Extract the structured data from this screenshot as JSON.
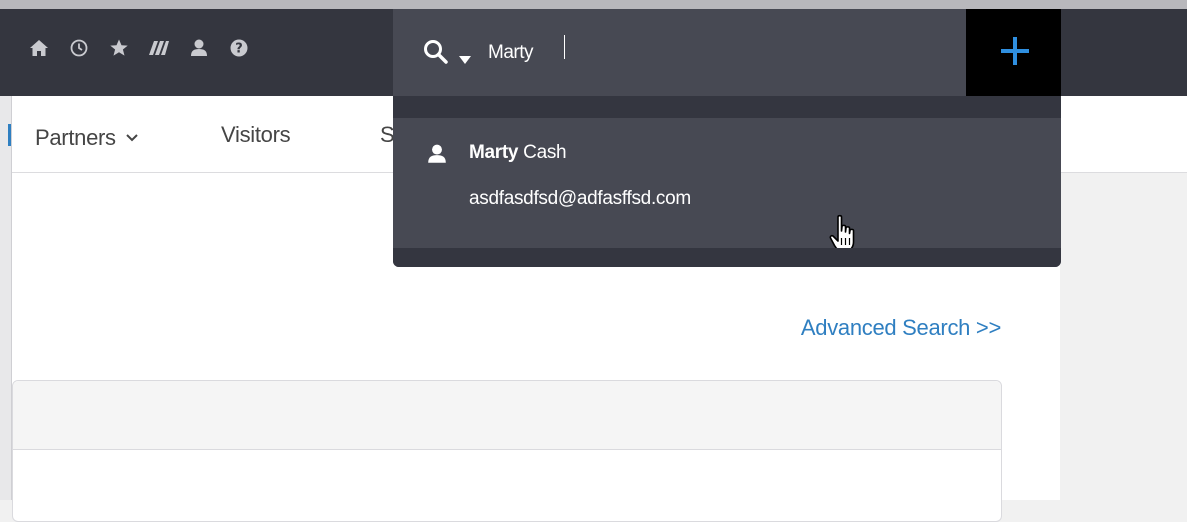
{
  "topbar": {
    "icons": [
      "home-icon",
      "clock-icon",
      "star-icon",
      "tickets-icon",
      "user-icon",
      "help-icon"
    ],
    "add_symbol": "+"
  },
  "search": {
    "value": "Marty",
    "icon": "search-icon",
    "scope_icon": "caret-down-icon"
  },
  "nav": {
    "items": [
      {
        "label": "Partners"
      },
      {
        "label": "Visitors"
      },
      {
        "label": "S"
      }
    ]
  },
  "dropdown": {
    "results": [
      {
        "name_bold": "Marty",
        "name_rest": " Cash",
        "email": "asdfasdfsd@adfasffsd.com",
        "icon": "user-icon"
      }
    ]
  },
  "main": {
    "advanced_search_label": "Advanced Search >>"
  },
  "colors": {
    "topbar_bg": "#34363f",
    "search_bg": "#474953",
    "link": "#2f7fc1",
    "add_icon": "#2f8fe0"
  }
}
